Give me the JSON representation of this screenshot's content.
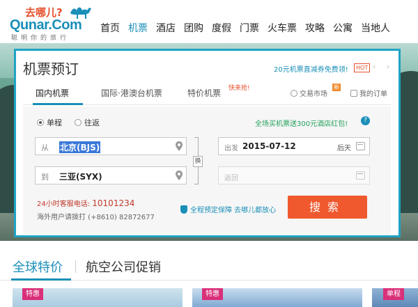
{
  "logo": {
    "tagline": "去哪儿?",
    "name": "Qunar.Com",
    "slogan": "聪明你的旅行"
  },
  "nav": {
    "items": [
      "首页",
      "机票",
      "酒店",
      "团购",
      "度假",
      "门票",
      "火车票",
      "攻略",
      "公寓",
      "当地人"
    ],
    "active_index": 1
  },
  "booking": {
    "title": "机票预订",
    "promo": "20元机票直减券免费领!",
    "promo_badge": "HOT",
    "promo_prev": "‹",
    "promo_next": "›",
    "tabs": [
      "国内机票",
      "国际·港澳台机票",
      "特价机票"
    ],
    "tab_badge": "快来抢!",
    "market": "交易市场",
    "market_badge": "新",
    "my_orders": "我的订单",
    "trip_types": [
      "单程",
      "往返"
    ],
    "hotel_promo": "全场买机票送300元酒店红包!",
    "help": "?",
    "from_label": "从",
    "from_value": "北京(BJS)",
    "to_label": "到",
    "to_value": "三亚(SYX)",
    "swap_label": "换",
    "depart_label": "出发",
    "depart_date": "2015-07-12",
    "depart_weekday": "后天",
    "return_placeholder": "返回",
    "hotline_label": "24小时客服电话:",
    "hotline_number": "10101234",
    "overseas": "海外用户请拨打 (+8610) 82872677",
    "guarantee": "全程预定保障 去哪儿都放心",
    "search_button": "搜索"
  },
  "section": {
    "tabs": [
      "全球特价",
      "航空公司促销"
    ],
    "cards": [
      {
        "tag": "特惠"
      },
      {
        "tag": "特惠"
      },
      {
        "tag": "单程"
      }
    ]
  },
  "colors": {
    "brand": "#1a8fb8",
    "panel_border": "#1fa3c4",
    "search": "#f0592e",
    "promo_green": "#23a05b",
    "tag_pink": "#d9307a"
  }
}
